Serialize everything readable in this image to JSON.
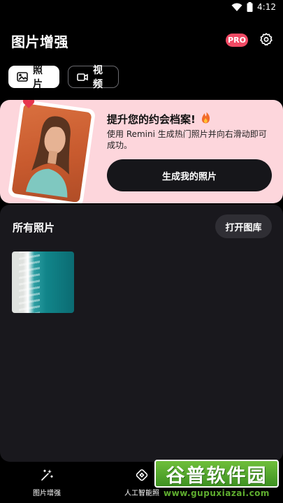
{
  "status_bar": {
    "time": "4:12"
  },
  "header": {
    "title": "图片增强",
    "pro_badge": "PRO"
  },
  "tabs": [
    {
      "label": "照片",
      "icon": "image-icon",
      "active": true
    },
    {
      "label": "视频",
      "icon": "video-camera-icon",
      "active": false
    }
  ],
  "promo": {
    "title": "提升您的约会档案!",
    "description": "使用 Remini 生成热门照片并向右滑动即可成功。",
    "button_label": "生成我的照片"
  },
  "gallery": {
    "title": "所有照片",
    "open_button_label": "打开图库"
  },
  "bottom_nav": [
    {
      "label": "图片增强",
      "icon": "sparkle-wand-icon"
    },
    {
      "label": "人工智能照",
      "icon": "ai-diamond-icon"
    }
  ],
  "watermark": {
    "brand": "谷普软件园",
    "url": "www.gupuxiazai.com"
  },
  "colors": {
    "promo_bg": "#fdd6dc",
    "pro_badge": "#f04a64",
    "gallery_bg": "#19181d"
  }
}
